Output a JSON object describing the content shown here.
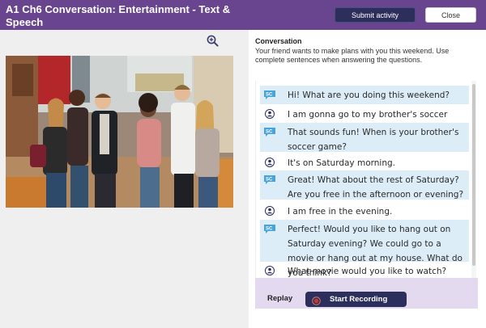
{
  "header": {
    "title": "A1 Ch6 Conversation: Entertainment - Text & Speech",
    "submit_label": "Submit activity",
    "close_label": "Close",
    "background_color": "#69458f",
    "submit_color": "#2c2f5c"
  },
  "conversation": {
    "heading": "Conversation",
    "prompt": "Your friend wants to make plans with you this weekend. Use complete sentences when answering the questions.",
    "messages": [
      {
        "speaker": "bot",
        "icon": "speech-bubble-icon",
        "text": "Hi! What are you doing this weekend?"
      },
      {
        "speaker": "user",
        "icon": "user-avatar-icon",
        "text": "I am gonna go to my brother's soccer game."
      },
      {
        "speaker": "bot",
        "icon": "speech-bubble-icon",
        "text": "That sounds fun! When is your brother's soccer game?"
      },
      {
        "speaker": "user",
        "icon": "user-avatar-icon",
        "text": "It's on Saturday morning."
      },
      {
        "speaker": "bot",
        "icon": "speech-bubble-icon",
        "text": "Great! What about the rest of Saturday? Are you free in the afternoon or evening?"
      },
      {
        "speaker": "user",
        "icon": "user-avatar-icon",
        "text": "I am free in the evening."
      },
      {
        "speaker": "bot",
        "icon": "speech-bubble-icon",
        "text": "Perfect! Would you like to hang out on Saturday evening? We could go to a movie or hang out at my house. What do you think?"
      },
      {
        "speaker": "user",
        "icon": "user-avatar-icon",
        "text": "What movie would you like to watch?"
      }
    ],
    "bot_bubble_color": "#dcedf7"
  },
  "controls": {
    "replay_label": "Replay",
    "record_label": "Start Recording",
    "record_dot_color": "#c0392b"
  },
  "image": {
    "icon": "zoom-in-icon",
    "subject": "group-of-students-photo"
  }
}
